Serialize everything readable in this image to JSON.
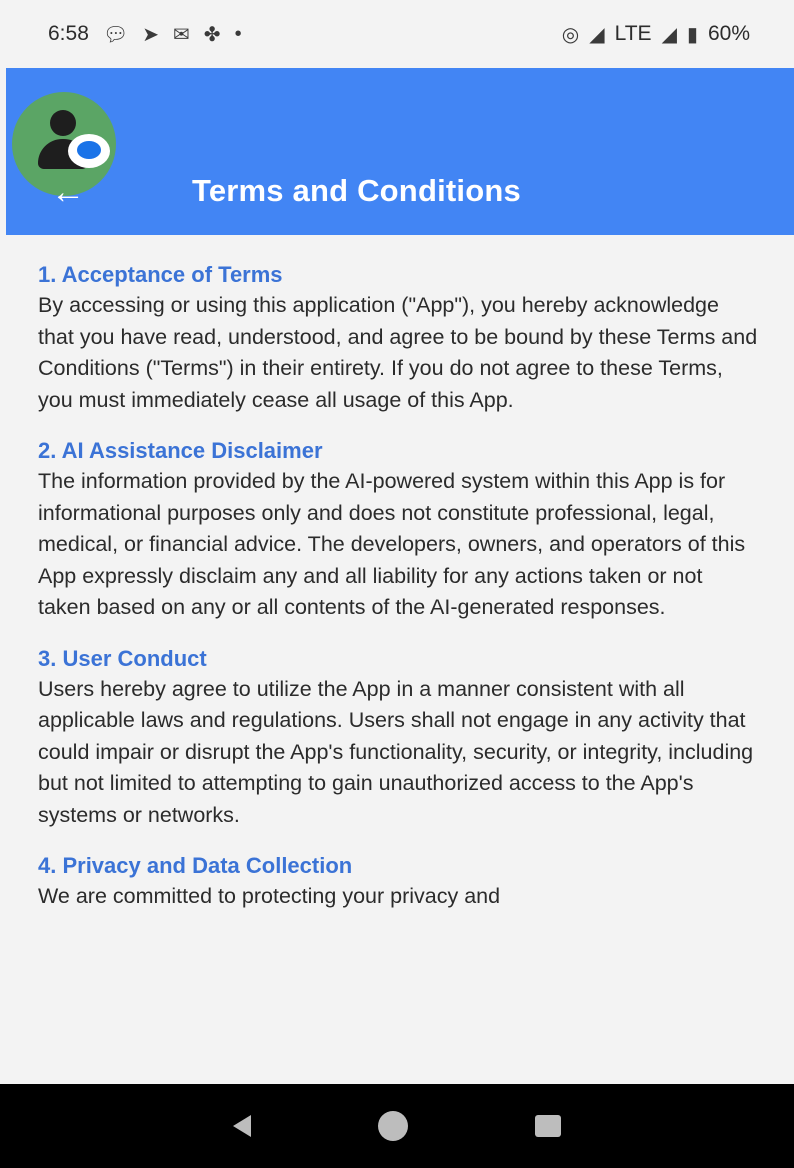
{
  "status_bar": {
    "time": "6:58",
    "left_icons": [
      "chat-notification-icon",
      "telegram-icon",
      "gmail-icon",
      "pinwheel-icon",
      "dot-icon"
    ],
    "right_icons": [
      "hotspot-icon",
      "signal-icon",
      "signal-icon",
      "battery-icon"
    ],
    "network": "LTE",
    "battery": "60%"
  },
  "app_bar": {
    "title": "Terms and Conditions",
    "background_color": "#4285f4",
    "avatar_color": "#5ba565"
  },
  "sections": [
    {
      "heading": "1. Acceptance of Terms",
      "body": "By accessing or using this application (\"App\"), you hereby acknowledge that you have read, understood, and agree to be bound by these Terms and Conditions (\"Terms\") in their entirety. If you do not agree to these Terms, you must immediately cease all usage of this App."
    },
    {
      "heading": "2. AI Assistance Disclaimer",
      "body": "The information provided by the AI-powered system within this App is for informational purposes only and does not constitute professional, legal, medical, or financial advice. The developers, owners, and operators of this App expressly disclaim any and all liability for any actions taken or not taken based on any or all contents of the AI-generated responses."
    },
    {
      "heading": "3. User Conduct",
      "body": "Users hereby agree to utilize the App in a manner consistent with all applicable laws and regulations. Users shall not engage in any activity that could impair or disrupt the App's functionality, security, or integrity, including but not limited to attempting to gain unauthorized access to the App's systems or networks."
    },
    {
      "heading": "4. Privacy and Data Collection",
      "body": "We are committed to protecting your privacy and"
    }
  ],
  "colors": {
    "heading": "#3b73d6",
    "page_background": "#f3f3f3"
  }
}
